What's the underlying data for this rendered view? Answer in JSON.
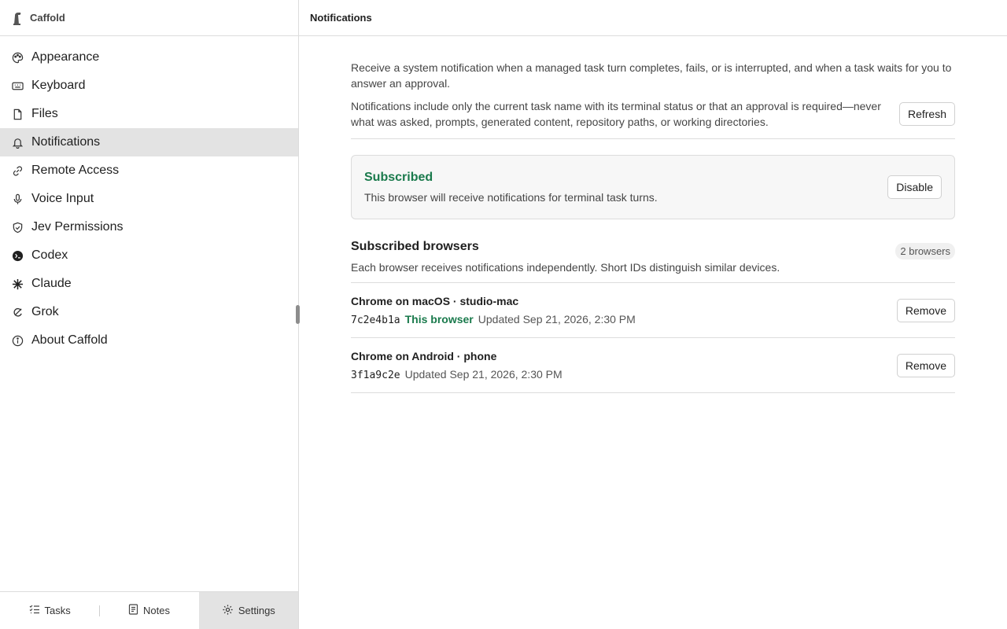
{
  "app": {
    "name": "Caffold"
  },
  "sidebar": {
    "items": [
      {
        "label": "Appearance",
        "icon": "palette-icon"
      },
      {
        "label": "Keyboard",
        "icon": "keyboard-icon"
      },
      {
        "label": "Files",
        "icon": "file-icon"
      },
      {
        "label": "Notifications",
        "icon": "bell-icon",
        "active": true
      },
      {
        "label": "Remote Access",
        "icon": "link-icon"
      },
      {
        "label": "Voice Input",
        "icon": "microphone-icon"
      },
      {
        "label": "Jev Permissions",
        "icon": "shield-icon"
      },
      {
        "label": "Codex",
        "icon": "codex-icon"
      },
      {
        "label": "Claude",
        "icon": "claude-icon"
      },
      {
        "label": "Grok",
        "icon": "grok-icon"
      },
      {
        "label": "About Caffold",
        "icon": "info-icon"
      }
    ]
  },
  "bottom_tabs": [
    {
      "label": "Tasks",
      "icon": "tasks-icon"
    },
    {
      "label": "Notes",
      "icon": "notes-icon"
    },
    {
      "label": "Settings",
      "icon": "gear-icon",
      "active": true
    }
  ],
  "main": {
    "title": "Notifications",
    "description_1": "Receive a system notification when a managed task turn completes, fails, or is interrupted, and when a task waits for you to answer an approval.",
    "description_2": "Notifications include only the current task name with its terminal status or that an approval is required—never what was asked, prompts, generated content, repository paths, or working directories.",
    "refresh_label": "Refresh",
    "status": {
      "title": "Subscribed",
      "description": "This browser will receive notifications for terminal task turns.",
      "action_label": "Disable"
    },
    "subscribed": {
      "title": "Subscribed browsers",
      "description": "Each browser receives notifications independently. Short IDs distinguish similar devices.",
      "count_label": "2 browsers",
      "browsers": [
        {
          "name": "Chrome on macOS · studio-mac",
          "id": "7c2e4b1a",
          "badge": "This browser",
          "updated": "Updated Sep 21, 2026, 2:30 PM",
          "action_label": "Remove"
        },
        {
          "name": "Chrome on Android · phone",
          "id": "3f1a9c2e",
          "badge": "",
          "updated": "Updated Sep 21, 2026, 2:30 PM",
          "action_label": "Remove"
        }
      ]
    }
  },
  "colors": {
    "accent_green": "#1a7a4c",
    "active_bg": "#e3e3e3",
    "border": "#dcdcdc"
  }
}
